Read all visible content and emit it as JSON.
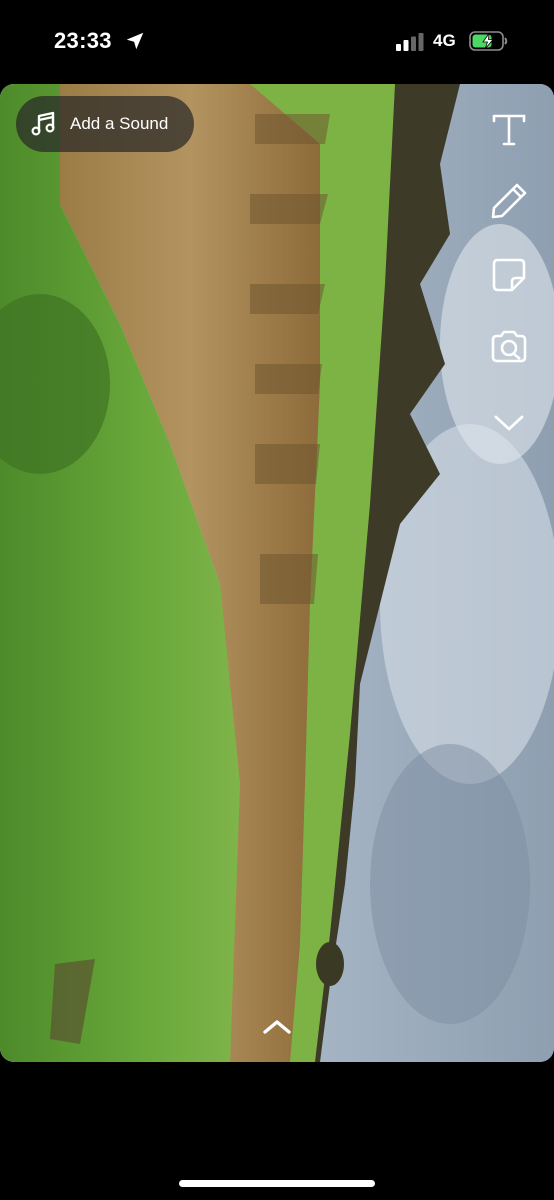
{
  "status_bar": {
    "time": "23:33",
    "network": "4G",
    "icons": [
      "location-arrow-icon",
      "signal-icon",
      "battery-charging-icon"
    ],
    "battery_color": "#4cd964"
  },
  "sound": {
    "label": "Add a Sound",
    "icon": "music-note-icon"
  },
  "tools": [
    "text-tool-icon",
    "pencil-icon",
    "sticker-icon",
    "camera-lens-icon",
    "chevron-down-icon"
  ],
  "swipe_up_icon": "chevron-up-icon",
  "colors": {
    "sky": "#b9c6d3",
    "grass_near": "#5f9d33",
    "grass_far": "#79aa3c",
    "dry_hedge": "#a58a55",
    "trees": "#3e3a2a"
  }
}
